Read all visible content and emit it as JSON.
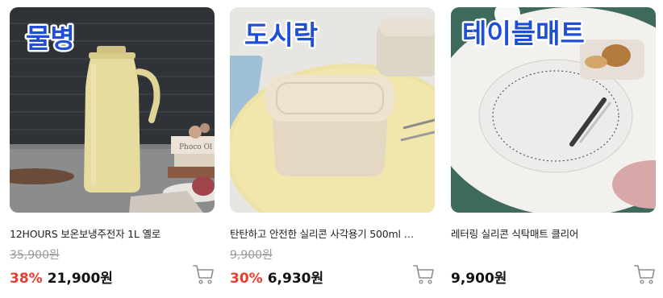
{
  "products": [
    {
      "badge": "물병",
      "name": "12HOURS 보온보냉주전자 1L 옐로",
      "original_price": "35,900원",
      "discount": "38%",
      "price": "21,900원",
      "image_text": "Phoco Ol"
    },
    {
      "badge": "도시락",
      "name": "탄탄하고 안전한 실리콘 사각용기 500ml …",
      "original_price": "9,900원",
      "discount": "30%",
      "price": "6,930원"
    },
    {
      "badge": "테이블매트",
      "name": "레터링 실리콘 식탁매트 클리어",
      "price": "9,900원"
    }
  ],
  "icons": {
    "cart": "shopping-cart-icon"
  },
  "colors": {
    "discount": "#ee3b2e",
    "badge": "#1f4fd6"
  }
}
